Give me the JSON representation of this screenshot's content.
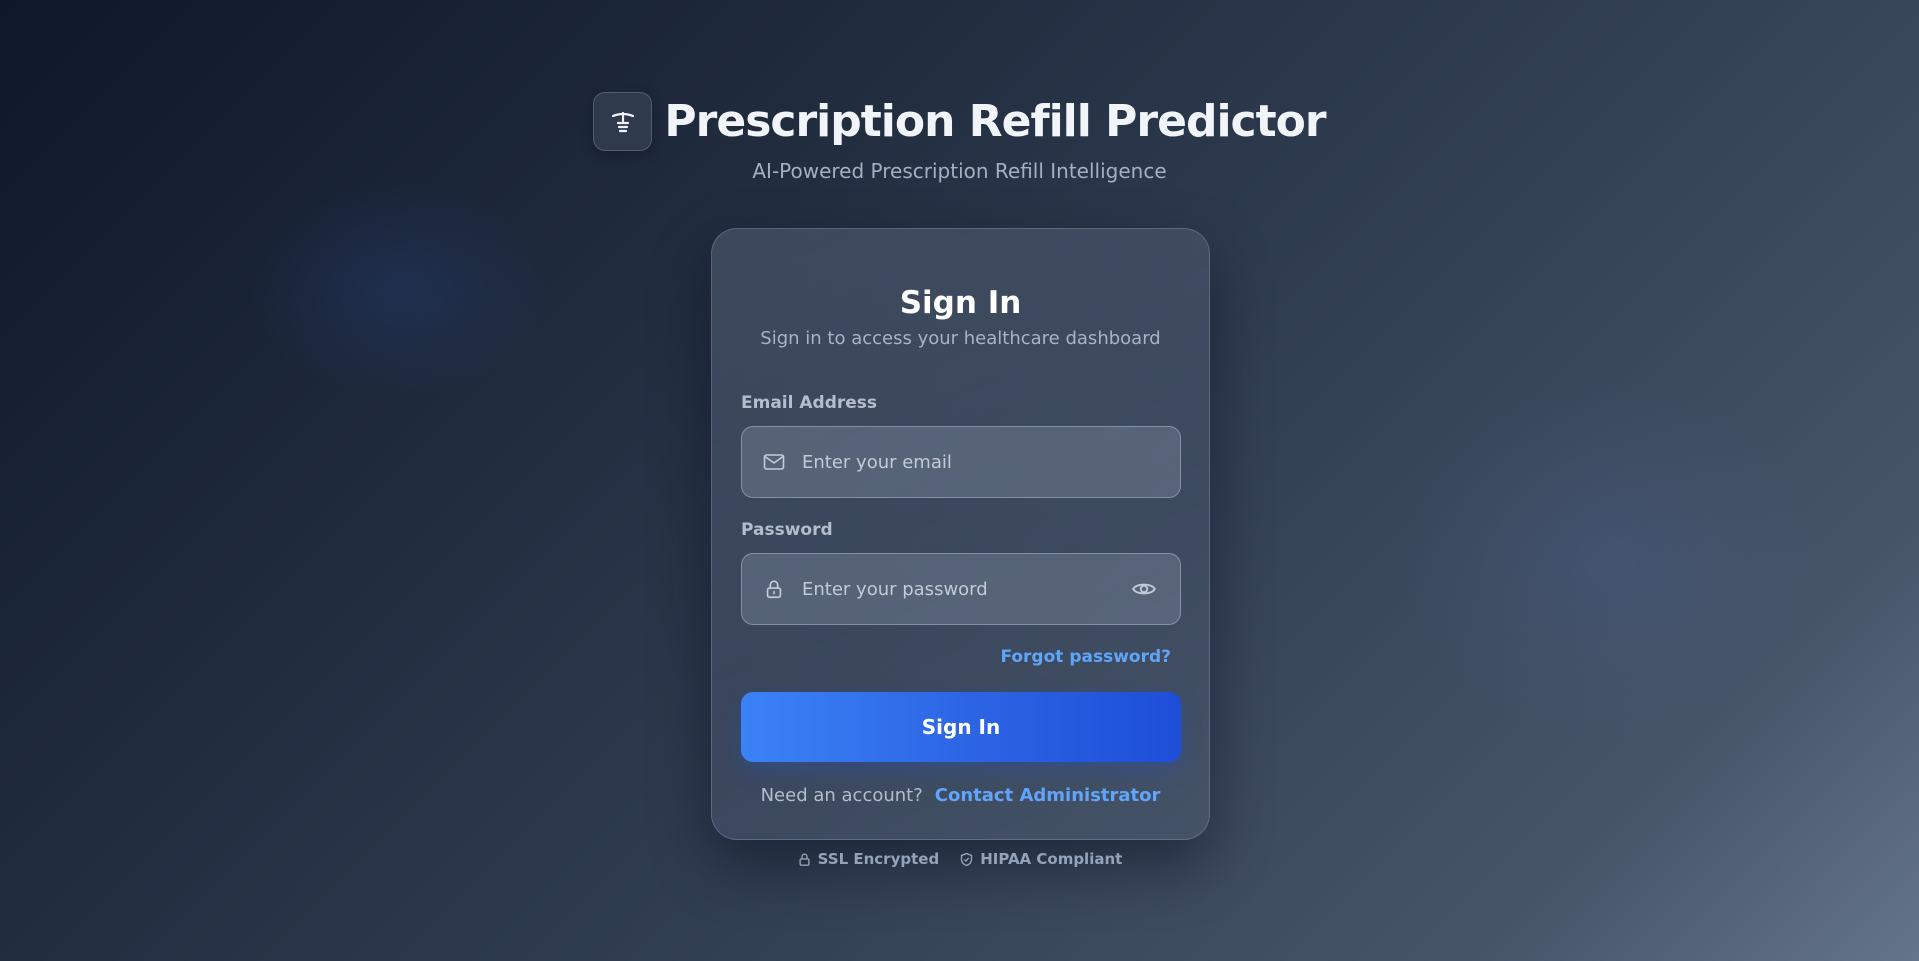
{
  "brand": {
    "title": "Prescription Refill Predictor",
    "subtitle": "AI-Powered Prescription Refill Intelligence",
    "logo_icon": "pharmacy-symbol-icon"
  },
  "form": {
    "title": "Sign In",
    "subtitle": "Sign in to access your healthcare dashboard",
    "email": {
      "label": "Email Address",
      "placeholder": "Enter your email",
      "value": "",
      "icon": "mail-icon"
    },
    "password": {
      "label": "Password",
      "placeholder": "Enter your password",
      "value": "",
      "icon": "lock-icon",
      "toggle_icon": "eye-icon"
    },
    "forgot_label": "Forgot password?",
    "submit_label": "Sign In",
    "account_prompt": "Need an account?",
    "contact_label": "Contact Administrator"
  },
  "footer": {
    "badges": [
      {
        "label": "SSL Encrypted",
        "icon": "lock-icon"
      },
      {
        "label": "HIPAA Compliant",
        "icon": "shield-icon"
      }
    ]
  },
  "colors": {
    "accent": "#3b82f6",
    "link": "#60a5fa",
    "background_dark": "#0f172a",
    "background_light": "#64748b"
  }
}
